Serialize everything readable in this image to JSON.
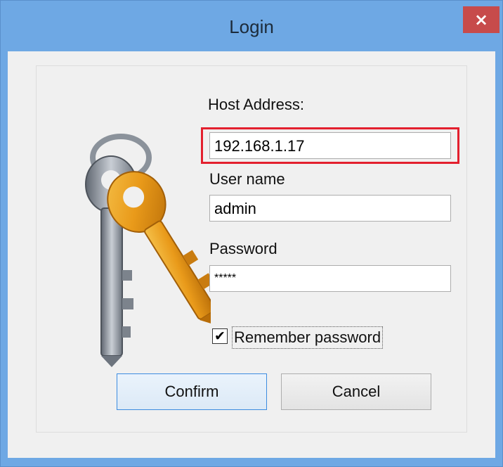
{
  "window": {
    "title": "Login",
    "close_glyph": "×",
    "accent_color": "#6ea8e4",
    "highlight_color": "#e3202e"
  },
  "illustration": {
    "icon": "keys-icon"
  },
  "form": {
    "host": {
      "label": "Host Address:",
      "value": "192.168.1.17"
    },
    "user": {
      "label": "User name",
      "value": "admin"
    },
    "password": {
      "label": "Password",
      "value": "*****"
    },
    "remember": {
      "label": "Remember password",
      "checked": true,
      "check_glyph": "✔"
    }
  },
  "buttons": {
    "confirm": "Confirm",
    "cancel": "Cancel"
  }
}
